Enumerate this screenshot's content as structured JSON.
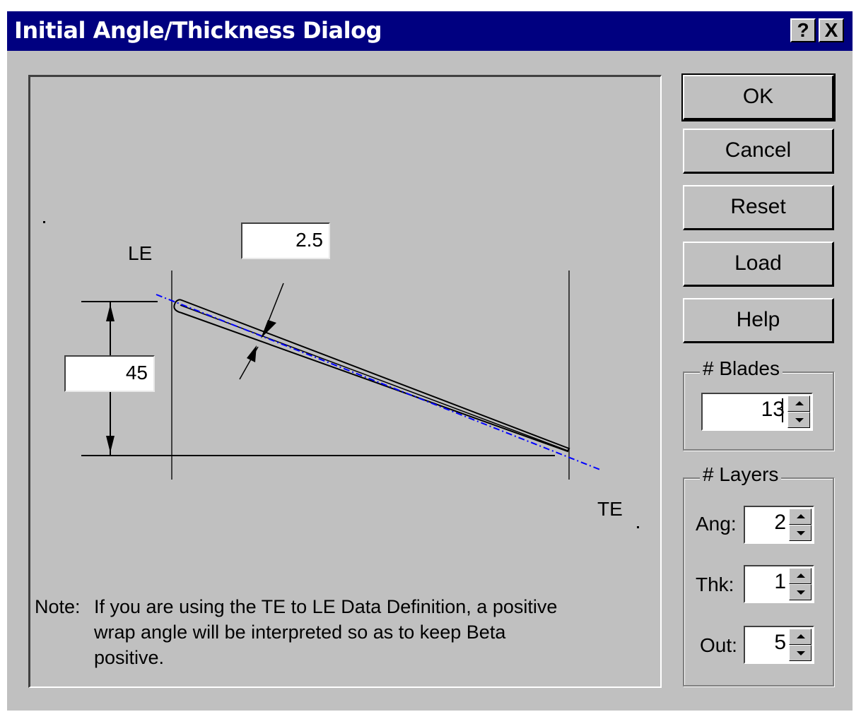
{
  "window": {
    "title": "Initial Angle/Thickness Dialog",
    "help_glyph": "?",
    "close_glyph": "X"
  },
  "drawing": {
    "thickness_value": "2.5",
    "angle_value": "45",
    "le_label": "LE",
    "te_label": "TE",
    "note_prefix": "Note:",
    "note_line1": "If you are using the TE to LE Data Definition, a positive",
    "note_line2": "wrap angle will be interpreted so as to keep Beta",
    "note_line3": "positive.",
    "camber_line_color": "#0000ff"
  },
  "buttons": {
    "ok": "OK",
    "cancel": "Cancel",
    "reset": "Reset",
    "load": "Load",
    "help": "Help"
  },
  "blades": {
    "title": "# Blades",
    "value": "13"
  },
  "layers": {
    "title": "# Layers",
    "ang_label": "Ang:",
    "ang_value": "2",
    "thk_label": "Thk:",
    "thk_value": "1",
    "out_label": "Out:",
    "out_value": "5"
  }
}
